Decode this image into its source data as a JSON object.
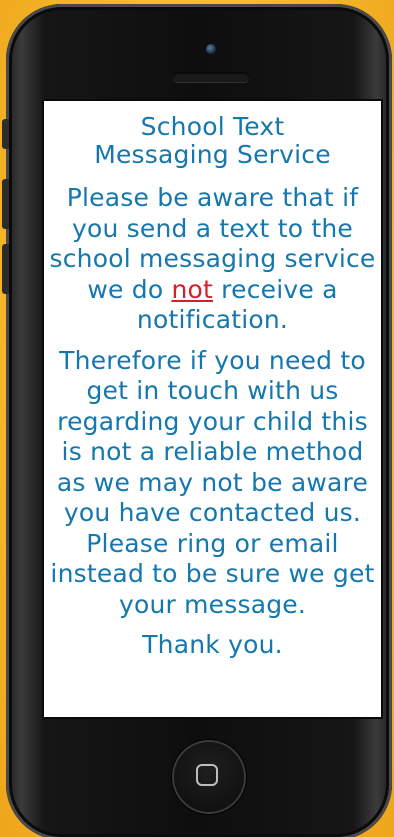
{
  "message": {
    "title_line1": "School Text",
    "title_line2": "Messaging Service",
    "para1_before": "Please be aware that if you send a text to the school messaging service we do ",
    "para1_emphasis": "not",
    "para1_after": " receive a notification.",
    "para2": "Therefore if you need to get in touch with us regarding your child this is not a reliable method as we may not be aware you have contacted us. Please ring or email instead to be sure we get your message.",
    "closing": "Thank you."
  },
  "colors": {
    "text": "#1477ad",
    "emphasis": "#d4202c",
    "background": "#f6b72a",
    "phone_body": "#0e0e0e"
  },
  "icons": {
    "camera": "camera-icon",
    "speaker": "speaker-grille",
    "home": "home-button-icon"
  }
}
